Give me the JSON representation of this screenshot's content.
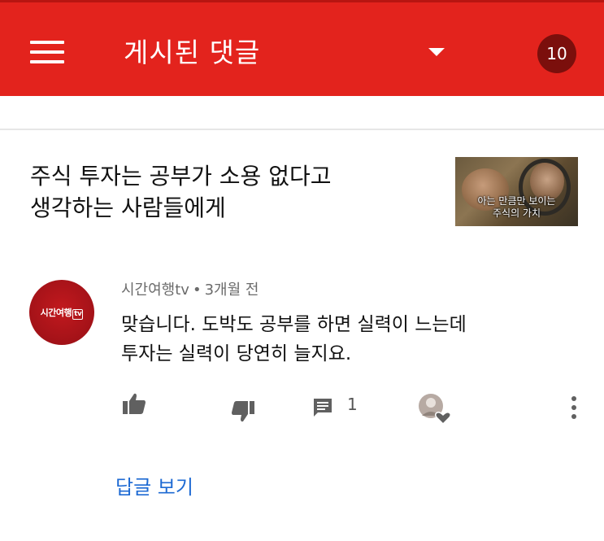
{
  "header": {
    "title": "게시된 댓글",
    "notification_count": "10",
    "accent_color": "#e3231d",
    "icons": [
      "menu-icon",
      "dropdown-caret-icon"
    ]
  },
  "video": {
    "title_line1": "주식 투자는 공부가 소용 없다고",
    "title_line2": "생각하는 사람들에게",
    "thumbnail_caption_line1": "아는 만큼만 보이는",
    "thumbnail_caption_line2": "주식의 가치"
  },
  "comment": {
    "author": "시간여행tv",
    "separator": "•",
    "time": "3개월 전",
    "avatar_text": "시간여행",
    "avatar_badge": "tv",
    "text_line1": "맞습니다. 도박도 공부를 하면 실력이 느는데",
    "text_line2": "투자는 실력이 당연히 늘지요.",
    "reply_count": "1",
    "actions": [
      "like-icon",
      "dislike-icon",
      "reply-icon",
      "creator-heart-icon",
      "more-icon"
    ]
  },
  "replies": {
    "view_label": "답글 보기",
    "link_color": "#1e6ad3"
  }
}
